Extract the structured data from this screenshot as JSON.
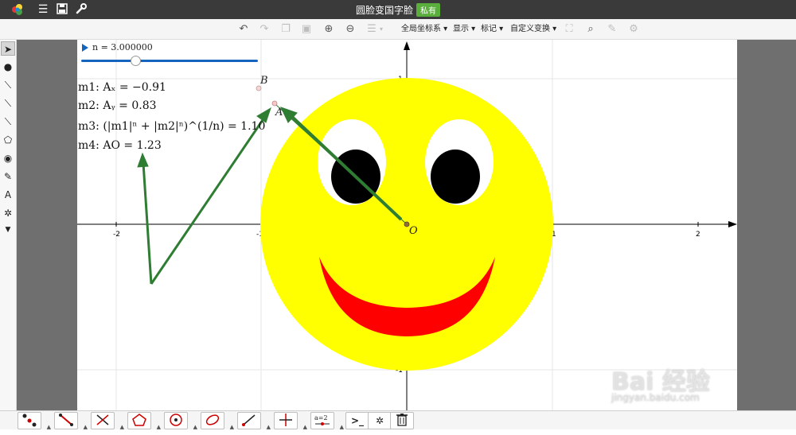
{
  "titlebar": {
    "title": "圆脸变国字脸",
    "badge": "私有",
    "icons": [
      "geogebra-logo-icon",
      "menu-icon",
      "save-icon",
      "wrench-icon"
    ]
  },
  "toolbar": {
    "menus": {
      "axes": "全局坐标系 ▾",
      "display": "显示 ▾",
      "mark": "标记 ▾",
      "transform": "自定义变换 ▾"
    }
  },
  "slider": {
    "label": "n = 3.000000",
    "value": 3.0
  },
  "measures": {
    "m1": "m1: Aₓ = −0.91",
    "m2": "m2: Aᵧ = 0.83",
    "m3": "m3: (|m1|ⁿ + |m2|ⁿ)^(1/n) = 1.10",
    "m4": "m4: AO = 1.23"
  },
  "axes": {
    "x_ticks": [
      "-2",
      "-1",
      "1",
      "2"
    ],
    "y_ticks": [
      "1",
      "-1"
    ]
  },
  "points": {
    "A": "A",
    "B": "B",
    "O": "O"
  },
  "colors": {
    "face": "#ffff00",
    "mouth": "#ff0000",
    "eyes": "#000000",
    "arrows": "#2e7d32",
    "slider": "#1565c0"
  },
  "watermark": {
    "main": "Bai 经验",
    "sub": "jingyan.baidu.com"
  }
}
